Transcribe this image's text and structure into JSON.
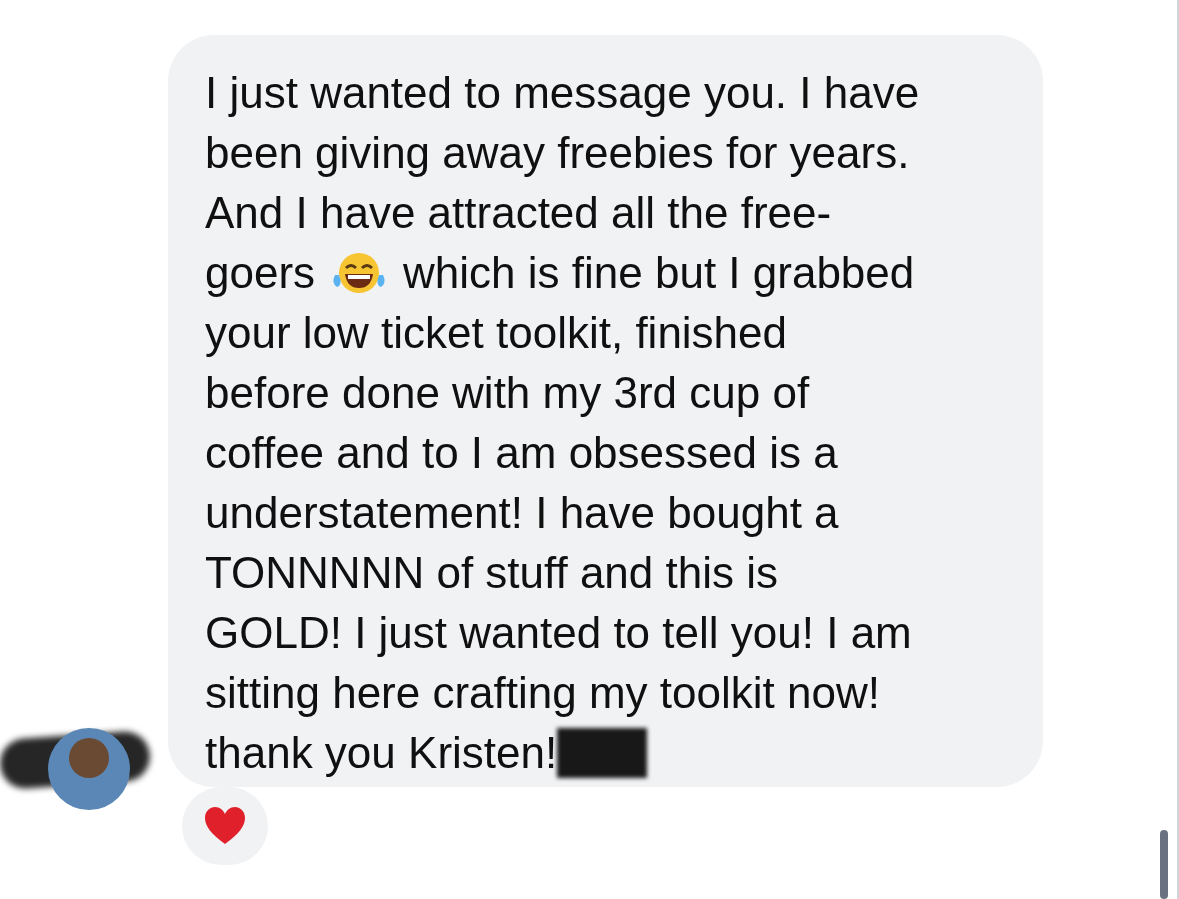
{
  "message": {
    "lines": [
      {
        "kind": "text",
        "text": "I just wanted to message you. I have"
      },
      {
        "kind": "text",
        "text": "been giving away freebies for years."
      },
      {
        "kind": "text",
        "text": "And I have attracted all the free-"
      },
      {
        "kind": "emoji",
        "before": "goers",
        "after": "which is fine but I grabbed"
      },
      {
        "kind": "text",
        "text": "your low ticket toolkit, finished"
      },
      {
        "kind": "text",
        "text": "before done with my 3rd cup of"
      },
      {
        "kind": "text",
        "text": "coffee and to I am obsessed is a"
      },
      {
        "kind": "text",
        "text": "understatement! I have bought a"
      },
      {
        "kind": "text",
        "text": "TONNNNN of stuff and this is"
      },
      {
        "kind": "text",
        "text": "GOLD! I just wanted to tell you! I am"
      },
      {
        "kind": "text",
        "text": "sitting here crafting my toolkit now!"
      },
      {
        "kind": "redacted",
        "text": "thank you Kristen!"
      }
    ]
  }
}
